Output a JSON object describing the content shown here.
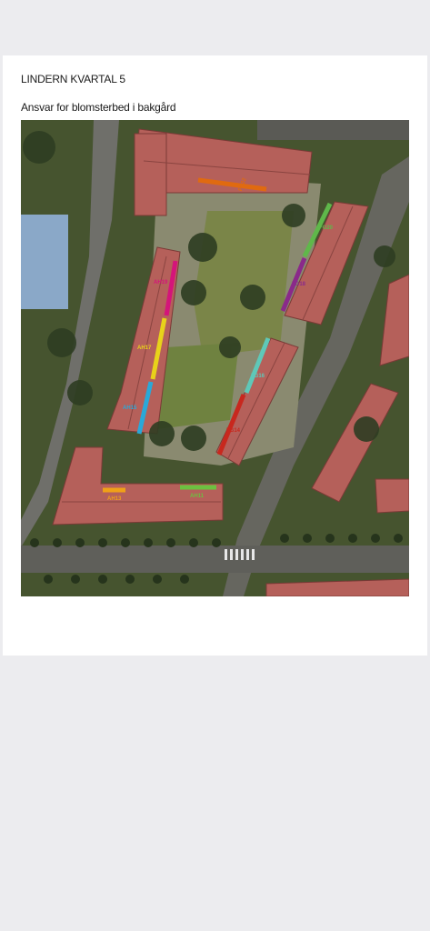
{
  "page": {
    "title": "LINDERN KVARTAL 5",
    "subtitle": "Ansvar for blomsterbed i bakgård"
  },
  "map": {
    "bed_labels": [
      {
        "id": "bed-fg22",
        "text": "FG22",
        "color": "#e06a10"
      },
      {
        "id": "bed-fg20",
        "text": "FG20",
        "color": "#5fb84a"
      },
      {
        "id": "bed-fg18",
        "text": "FG18",
        "color": "#8a2a8a"
      },
      {
        "id": "bed-fg16",
        "text": "FG16",
        "color": "#5fc8b8"
      },
      {
        "id": "bed-fg14",
        "text": "FG14",
        "color": "#c8281e"
      },
      {
        "id": "bed-ah19",
        "text": "AH19",
        "color": "#d4157a"
      },
      {
        "id": "bed-ah17",
        "text": "AH17",
        "color": "#e8d21a"
      },
      {
        "id": "bed-ah15",
        "text": "AH15",
        "color": "#2aa8d8"
      },
      {
        "id": "bed-ah13",
        "text": "AH13",
        "color": "#f0a018"
      },
      {
        "id": "bed-ah11",
        "text": "AH11",
        "color": "#6cc040"
      }
    ]
  }
}
